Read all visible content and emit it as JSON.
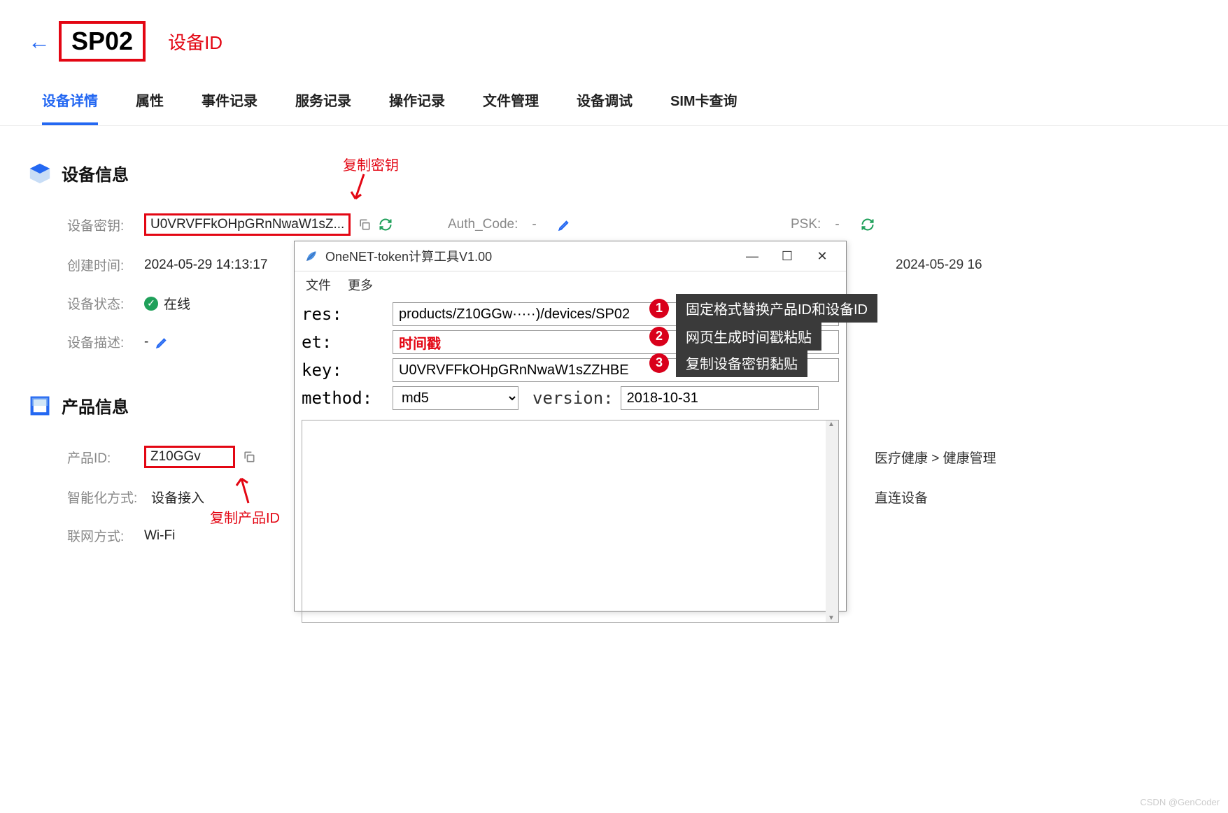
{
  "header": {
    "device_name": "SP02",
    "device_id_label": "设备ID"
  },
  "tabs": [
    "设备详情",
    "属性",
    "事件记录",
    "服务记录",
    "操作记录",
    "文件管理",
    "设备调试",
    "SIM卡查询"
  ],
  "device_info": {
    "section_title": "设备信息",
    "key_label": "设备密钥:",
    "key_value": "U0VRVFFkOHpGRnNwaW1sZ...",
    "auth_label": "Auth_Code:",
    "auth_value": "-",
    "psk_label": "PSK:",
    "psk_value": "-",
    "create_label": "创建时间:",
    "create_value": "2024-05-29 14:13:17",
    "timestamp_right": "2024-05-29 16",
    "status_label": "设备状态:",
    "status_value": "在线",
    "desc_label": "设备描述:",
    "desc_value": "-"
  },
  "product_info": {
    "section_title": "产品信息",
    "id_label": "产品ID:",
    "id_value": "Z10GGv",
    "smart_label": "智能化方式:",
    "smart_value": "设备接入",
    "net_label": "联网方式:",
    "net_value": "Wi-Fi",
    "breadcrumb": "医疗健康 > 健康管理",
    "smart_right": "直连设备"
  },
  "annotations": {
    "copy_key": "复制密钥",
    "copy_product": "复制产品ID"
  },
  "dialog": {
    "title": "OneNET-token计算工具V1.00",
    "menu": [
      "文件",
      "更多"
    ],
    "res_label": "res:",
    "res_value": "products/Z10GGw·····)/devices/SP02",
    "et_label": "et:",
    "et_value": "时间戳",
    "key_label": "key:",
    "key_value": "U0VRVFFkOHpGRnNwaW1sZZHBE",
    "method_label": "method:",
    "method_value": "md5",
    "version_label": "version:",
    "version_value": "2018-10-31"
  },
  "callouts": [
    {
      "num": "1",
      "text": "固定格式替换产品ID和设备ID"
    },
    {
      "num": "2",
      "text": "网页生成时间戳粘贴"
    },
    {
      "num": "3",
      "text": "复制设备密钥黏贴"
    }
  ],
  "watermark": "CSDN @GenCoder"
}
